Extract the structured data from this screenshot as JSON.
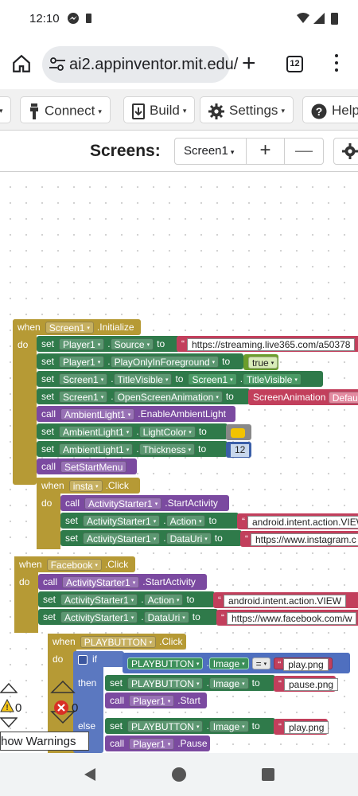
{
  "status": {
    "time": "12:10"
  },
  "browser": {
    "url": "ai2.appinventor.mit.edu/",
    "tab_count": "12"
  },
  "toolbar": {
    "connect_label": "Connect",
    "build_label": "Build",
    "settings_label": "Settings",
    "help_label": "Help"
  },
  "screens": {
    "label": "Screens:",
    "selected": "Screen1",
    "add_symbol": "+",
    "remove_symbol": "—"
  },
  "blocks": {
    "when": "when",
    "do": "do",
    "set": "set",
    "to": "to",
    "call": "call",
    "then": "then",
    "else": "else",
    "if": "if",
    "eq": "=",
    "screen1": "Screen1",
    "initialize": ".Initialize",
    "player1": "Player1",
    "source": "Source",
    "source_url": "https://streaming.live365.com/a50378",
    "play_only": "PlayOnlyInForeground",
    "true_val": "true",
    "title_visible": "TitleVisible",
    "open_anim": "OpenScreenAnimation",
    "screen_anim": "ScreenAnimation",
    "default_val": "Defau",
    "ambient": "AmbientLight1",
    "enable_ambient": ".EnableAmbientLight",
    "light_color": "LightColor",
    "thickness": "Thickness",
    "thickness_val": "12",
    "set_start_menu": "SetStartMenu",
    "insta": "insta",
    "click": ".Click",
    "activity": "ActivityStarter1",
    "start_activity": ".StartActivity",
    "action": "Action",
    "action_val": "android.intent.action.VIEW",
    "action_val2": "android.intent.action.VIEW",
    "data_uri": "DataUri",
    "insta_url": "https://www.instagram.c",
    "fb_url": "https://www.facebook.com/w",
    "facebook": "Facebook",
    "playbutton": "PLAYBUTTON",
    "image": "Image",
    "play_png": "play.png",
    "pause_png": "pause.png",
    "start": ".Start",
    "pause": ".Pause"
  },
  "warnings": {
    "warn_count": "0",
    "error_count": "0",
    "show_label": "how Warnings"
  }
}
